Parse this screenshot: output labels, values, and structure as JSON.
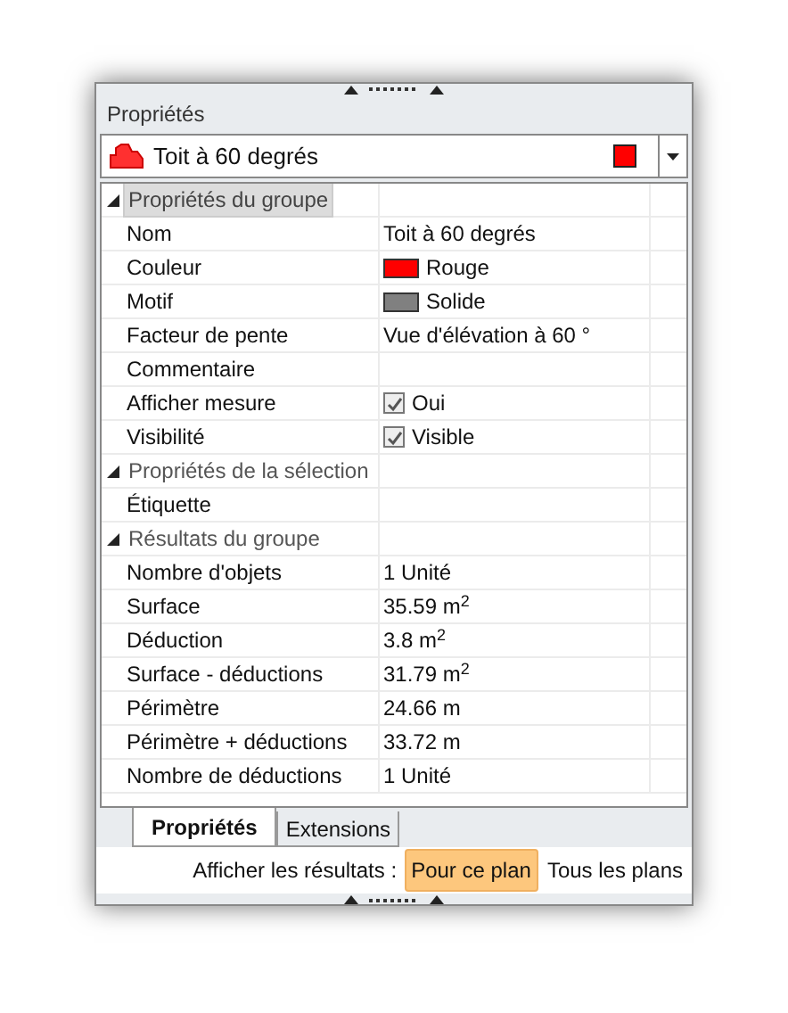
{
  "panel": {
    "title": "Propriétés"
  },
  "selector": {
    "label": "Toit à 60 degrés",
    "color": "#ff0000"
  },
  "grid": {
    "categories": [
      {
        "label": "Propriétés du groupe",
        "expanded": true,
        "selected": true,
        "children": [
          {
            "kind": "text",
            "name": "Nom",
            "value": "Toit à 60 degrés"
          },
          {
            "kind": "color",
            "name": "Couleur",
            "value": "Rouge",
            "color": "#ff0000"
          },
          {
            "kind": "color",
            "name": "Motif",
            "value": "Solide",
            "color": "#808080"
          },
          {
            "kind": "text",
            "name": "Facteur de pente",
            "value": "Vue d'élévation à 60 °"
          },
          {
            "kind": "text",
            "name": "Commentaire"
          },
          {
            "kind": "checkbox",
            "name": "Afficher mesure",
            "value": "Oui",
            "checked": true
          },
          {
            "kind": "checkbox",
            "name": "Visibilité",
            "value": "Visible",
            "checked": true
          }
        ]
      },
      {
        "label": "Propriétés de la sélection",
        "expanded": true,
        "selected": false,
        "children": [
          {
            "kind": "text",
            "name": "Étiquette"
          }
        ]
      },
      {
        "label": "Résultats du groupe",
        "expanded": true,
        "selected": false,
        "children": [
          {
            "kind": "text",
            "name": "Nombre d'objets",
            "value": "1 Unité"
          },
          {
            "kind": "text",
            "name": "Surface",
            "value": "35.59 m$^{2}$"
          },
          {
            "kind": "text",
            "name": "Déduction",
            "value": "3.8 m$^{2}$"
          },
          {
            "kind": "text",
            "name": "Surface - déductions",
            "value": "31.79 m$^{2}$"
          },
          {
            "kind": "text",
            "name": "Périmètre",
            "value": "24.66 m"
          },
          {
            "kind": "text",
            "name": "Périmètre + déductions",
            "value": "33.72 m"
          },
          {
            "kind": "text",
            "name": "Nombre de déductions",
            "value": "1 Unité"
          }
        ]
      }
    ]
  },
  "tabs": [
    {
      "label": "Propriétés",
      "selected": true
    },
    {
      "label": "Extensions",
      "selected": false
    }
  ],
  "results_toggle": {
    "label": "Afficher les résultats :",
    "options": [
      {
        "label": "Pour ce plan",
        "selected": true
      },
      {
        "label": "Tous les plans",
        "selected": false
      }
    ]
  }
}
